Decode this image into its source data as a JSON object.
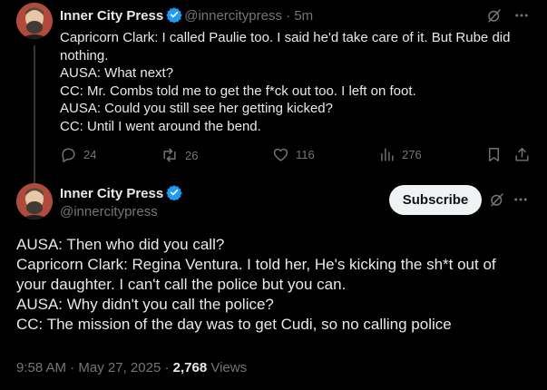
{
  "tweet1": {
    "author_name": "Inner City Press",
    "handle": "@innercitypress",
    "separator": "·",
    "time": "5m",
    "lines": [
      "Capricorn Clark: I called Paulie too. I said he'd take care of it. But Rube did",
      "nothing.",
      "AUSA: What next?",
      "CC: Mr. Combs told me to get the f*ck out too. I left on foot.",
      "AUSA: Could you still see her getting kicked?",
      "CC: Until I went around the bend."
    ],
    "actions": {
      "replies": "24",
      "reposts": "26",
      "likes": "116",
      "views": "276"
    }
  },
  "tweet2": {
    "author_name": "Inner City Press",
    "handle": "@innercitypress",
    "subscribe_label": "Subscribe",
    "lines": [
      "AUSA: Then who did you call?",
      "Capricorn Clark: Regina Ventura. I told her, He's kicking the sh*t out of",
      "your daughter. I can't call the police but you can.",
      "AUSA: Why didn't you call the police?",
      "CC: The mission of the day was to get Cudi, so no calling police"
    ],
    "time": "9:58 AM",
    "date": "May 27, 2025",
    "views_count": "2,768",
    "views_label": "Views"
  },
  "colors": {
    "background": "#000000",
    "text": "#e7e9ea",
    "secondary": "#71767b",
    "verified": "#1d9bf0",
    "subscribe_bg": "#eff3f4"
  },
  "icons": [
    "verified-badge-icon",
    "grok-icon",
    "more-icon",
    "reply-icon",
    "repost-icon",
    "like-icon",
    "views-icon",
    "bookmark-icon",
    "share-icon"
  ]
}
